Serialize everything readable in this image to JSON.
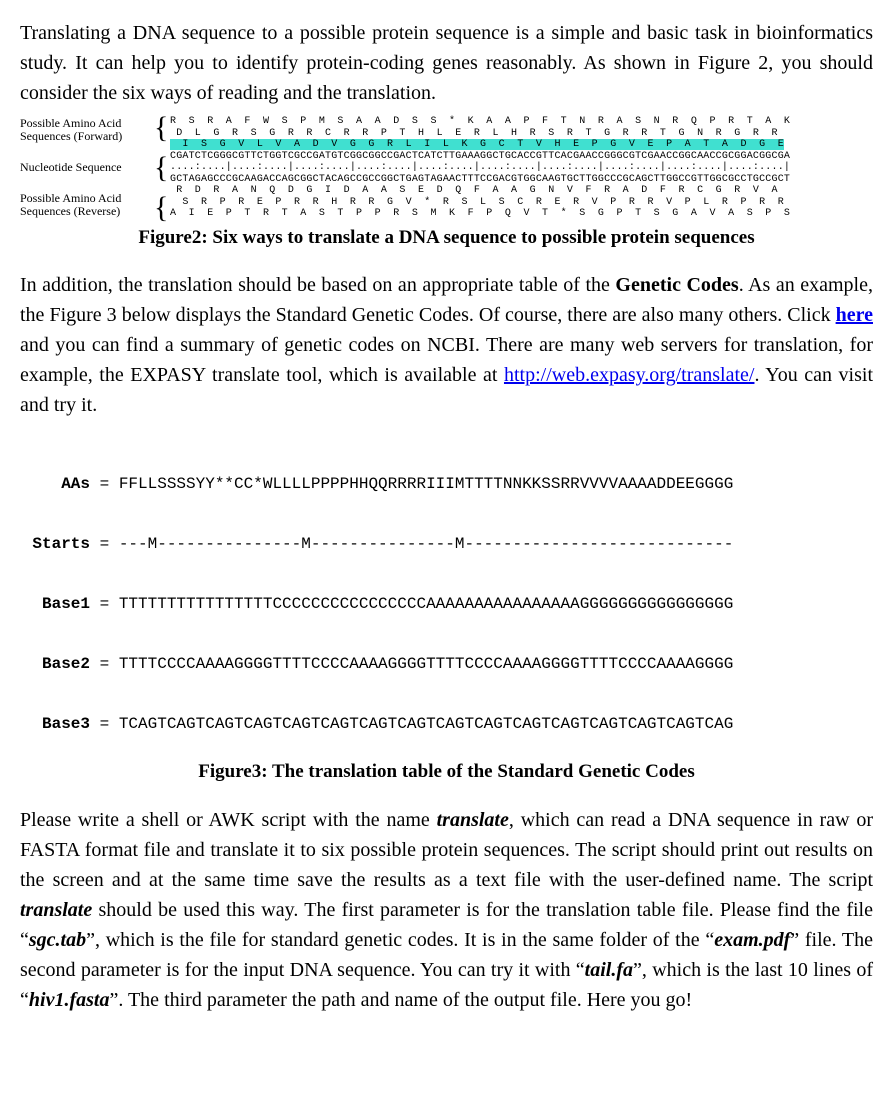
{
  "para1": {
    "text": "Translating a DNA sequence to a possible protein sequence is a simple and basic task in bioinformatics study. It can help you to identify protein-coding genes reasonably. As shown in Figure 2, you should consider the six ways of reading and the translation."
  },
  "fig2": {
    "label_fwd_l1": "Possible Amino Acid",
    "label_fwd_l2": "Sequences (Forward)",
    "label_nuc": "Nucleotide Sequence",
    "label_rev_l1": "Possible Amino Acid",
    "label_rev_l2": "Sequences (Reverse)",
    "frame_f1": "R  S  R  A  F  W  S  P  M  S  A  A  D  S  S  *  K  A  A  P  F  T  N  R  A  S  N  R  Q  P  R  T  A  K",
    "frame_f2": " D  L  G  R  S  G  R  R  C  R  R  P  T  H  L  E  R  L  H  R  S  R  T  G  R  R  T  G  N  R  G  R  R",
    "frame_f3": "  I  S  G  V  L  V  A  D  V  G  G  R  L  I  L  K  G  C  T  V  H  E  P  G  V  E  P  A  T  A  D  G  E",
    "nuc_top": "CGATCTCGGGCGTTCTGGTCGCCGATGTCGGCGGCCGACTCATCTTGAAAGGCTGCACCGTTCACGAACCGGGCGTCGAACCGGCAACCGCGGACGGCGA",
    "ruler": "....:....|....:....|....:....|....:....|....:....|....:....|....:....|....:....|....:....|....:....|",
    "nuc_bot": "GCTAGAGCCCGCAAGACCAGCGGCTACAGCCGCCGGCTGAGTAGAACTTTCCGACGTGGCAAGTGCTTGGCCCGCAGCTTGGCCGTTGGCGCCTGCCGCT",
    "frame_r1": " R  D  R  A  N  Q  D  G  I  D  A  A  S  E  D  Q  F  A  A  G  N  V  F  R  A  D  F  R  C  G  R  V  A",
    "frame_r2": "  S  R  P  R  E  P  R  R  H  R  R  G  V  *  R  S  L  S  C  R  E  R  V  P  R  R  V  P  L  R  P  R  R",
    "frame_r3": "A  I  E  P  T  R  T  A  S  T  P  P  R  S  M  K  F  P  Q  V  T  *  S  G  P  T  S  G  A  V  A  S  P  S",
    "caption": "Figure2: Six ways to translate a DNA sequence to possible protein sequences"
  },
  "para2": {
    "pre": "In addition, the translation should be based on an appropriate table of the ",
    "bold1": "Genetic Codes",
    "mid1": ". As an example, the Figure 3 below displays the Standard Genetic Codes. Of course, there are also many others. Click ",
    "link1_text": "here",
    "mid2": " and you can find a summary of genetic codes on NCBI. There are many web servers for translation, for example, the EXPASY translate tool, which is available at ",
    "link2_text": "http://web.expasy.org/translate/",
    "post": ". You can visit and try it."
  },
  "genetic_table": {
    "rows": [
      {
        "label": "AAs",
        "eq": " = ",
        "val": "FFLLSSSSYY**CC*WLLLLPPPPHHQQRRRRIIIMTTTTNNKKSSRRVVVVAAAADDEEGGGG"
      },
      {
        "label": "Starts",
        "eq": " = ",
        "val": "---M---------------M---------------M----------------------------"
      },
      {
        "label": "Base1",
        "eq": " = ",
        "val": "TTTTTTTTTTTTTTTTCCCCCCCCCCCCCCCCAAAAAAAAAAAAAAAAGGGGGGGGGGGGGGGG"
      },
      {
        "label": "Base2",
        "eq": " = ",
        "val": "TTTTCCCCAAAAGGGGTTTTCCCCAAAAGGGGTTTTCCCCAAAAGGGGTTTTCCCCAAAAGGGG"
      },
      {
        "label": "Base3",
        "eq": " = ",
        "val": "TCAGTCAGTCAGTCAGTCAGTCAGTCAGTCAGTCAGTCAGTCAGTCAGTCAGTCAGTCAGTCAG"
      }
    ],
    "caption": "Figure3: The translation table of the Standard Genetic Codes"
  },
  "para3": {
    "t1": "Please write a shell or AWK script with the name ",
    "bi1": "translate",
    "t2": ", which can read a DNA sequence in raw or FASTA format file and translate it to six possible protein sequences. The script should print out results on the screen and at the same time save the results as a text file with the user-defined name. The script ",
    "bi2": "translate",
    "t3": " should be used this way. The first parameter is for the translation table file. Please find the file “",
    "bi3": "sgc.tab",
    "t4": "”, which is the file for standard genetic codes. It is in the same folder of the “",
    "bi4": "exam.pdf",
    "t5": "” file. The second parameter is for the input DNA sequence. You can try it with “",
    "bi5": "tail.fa",
    "t6": "”, which is the last 10 lines of “",
    "bi6": "hiv1.fasta",
    "t7": "”. The third parameter the path and name of the output file. Here you go!"
  }
}
